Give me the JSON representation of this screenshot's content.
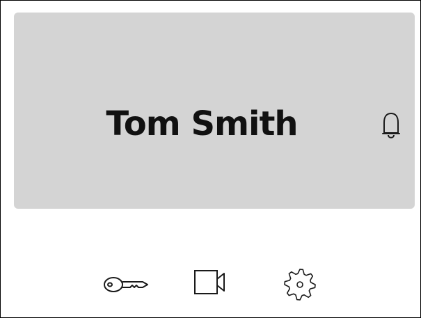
{
  "profile": {
    "name": "Tom Smith"
  },
  "icons": {
    "notification": "bell-icon",
    "key": "key-icon",
    "video": "video-camera-icon",
    "settings": "gear-icon"
  },
  "colors": {
    "card_background": "#d4d4d4",
    "text": "#111111",
    "icon_stroke": "#1a1a1a",
    "page_background": "#ffffff"
  }
}
